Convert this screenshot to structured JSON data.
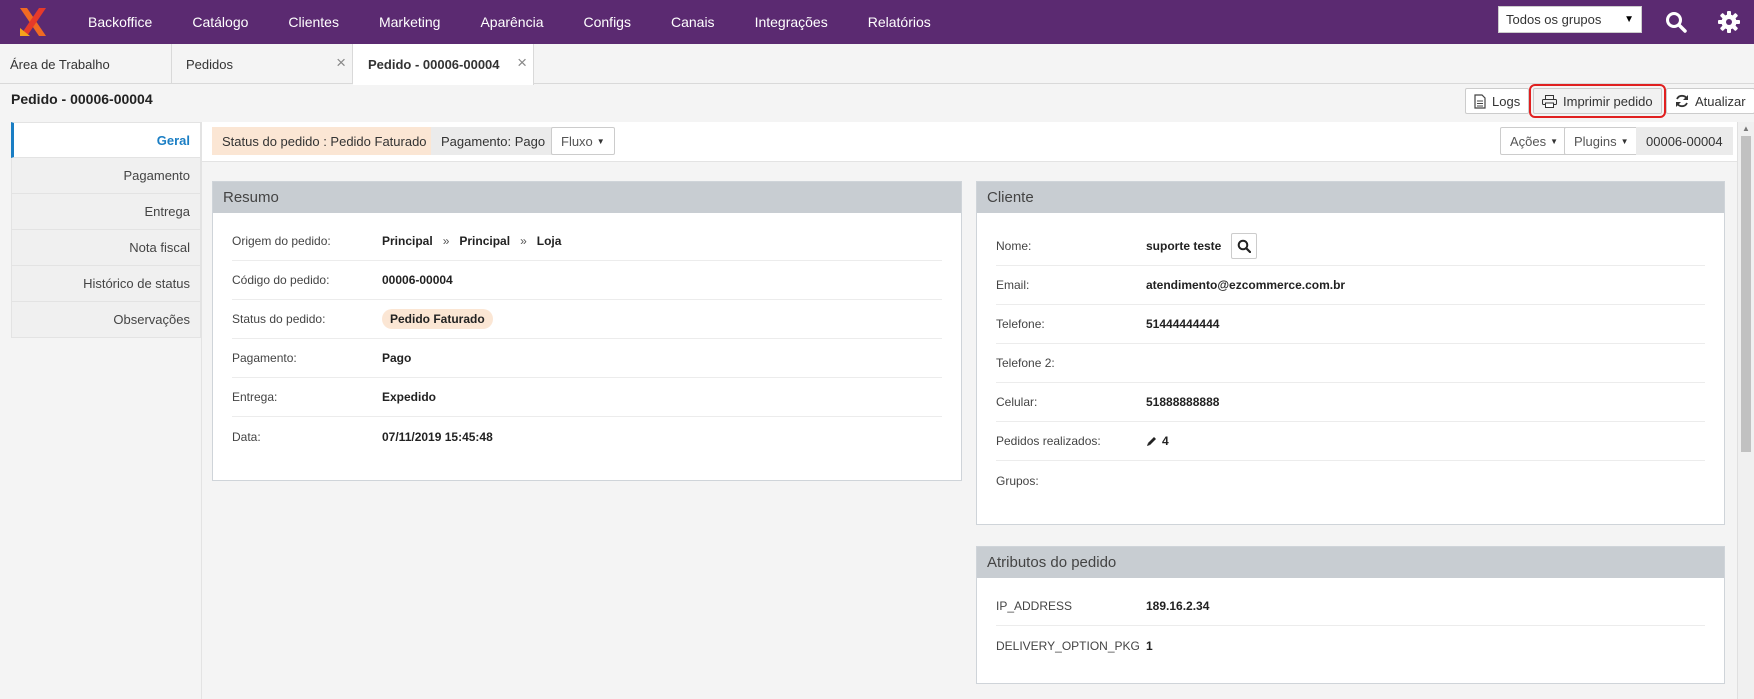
{
  "nav": {
    "items": [
      "Backoffice",
      "Catálogo",
      "Clientes",
      "Marketing",
      "Aparência",
      "Configs",
      "Canais",
      "Integrações",
      "Relatórios"
    ],
    "group_select": "Todos os grupos"
  },
  "tabs": {
    "workspace": "Área de Trabalho",
    "orders": "Pedidos",
    "order_detail": "Pedido - 00006-00004"
  },
  "header": {
    "title": "Pedido - 00006-00004",
    "logs": "Logs",
    "print": "Imprimir pedido",
    "refresh": "Atualizar"
  },
  "sidebar": {
    "items": [
      "Geral",
      "Pagamento",
      "Entrega",
      "Nota fiscal",
      "Histórico de status",
      "Observações"
    ]
  },
  "statusbar": {
    "order_status": "Status do pedido : Pedido Faturado",
    "payment": "Pagamento: Pago",
    "flow": "Fluxo",
    "actions": "Ações",
    "plugins": "Plugins",
    "code": "00006-00004"
  },
  "resumo": {
    "title": "Resumo",
    "origem_label": "Origem do pedido:",
    "origem": [
      "Principal",
      "Principal",
      "Loja"
    ],
    "codigo_label": "Código do pedido:",
    "codigo": "00006-00004",
    "status_label": "Status do pedido:",
    "status": "Pedido Faturado",
    "pagamento_label": "Pagamento:",
    "pagamento": "Pago",
    "entrega_label": "Entrega:",
    "entrega": "Expedido",
    "data_label": "Data:",
    "data": "07/11/2019 15:45:48"
  },
  "cliente": {
    "title": "Cliente",
    "nome_label": "Nome:",
    "nome": "suporte teste",
    "email_label": "Email:",
    "email": "atendimento@ezcommerce.com.br",
    "telefone_label": "Telefone:",
    "telefone": "51444444444",
    "telefone2_label": "Telefone 2:",
    "celular_label": "Celular:",
    "celular": "51888888888",
    "pedidos_label": "Pedidos realizados:",
    "pedidos": "4",
    "grupos_label": "Grupos:"
  },
  "atributos": {
    "title": "Atributos do pedido",
    "ip_label": "IP_ADDRESS",
    "ip": "189.16.2.34",
    "delivery_label": "DELIVERY_OPTION_PKG",
    "delivery": "1"
  },
  "colors": {
    "nav_bg": "#5b2a71",
    "accent": "#1a7ec4",
    "status_bg": "#fbe6d4",
    "highlight": "#e02020"
  }
}
